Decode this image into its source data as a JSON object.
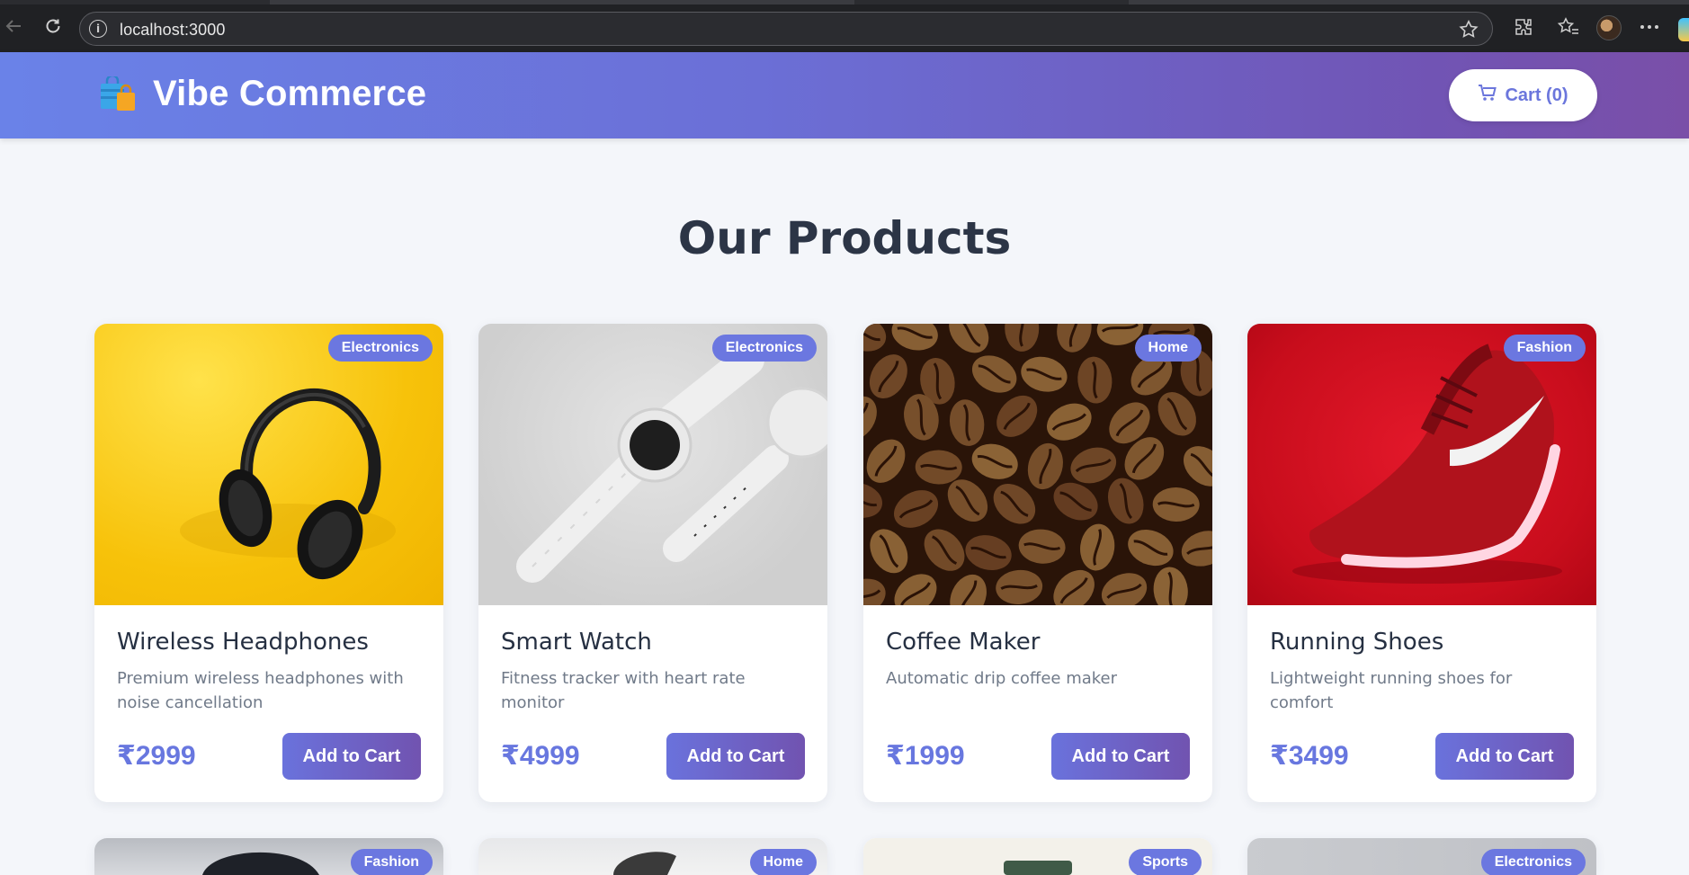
{
  "browser": {
    "url": "localhost:3000"
  },
  "header": {
    "brand": "Vibe Commerce",
    "cart_label": "Cart (0)"
  },
  "main": {
    "title": "Our Products",
    "products": [
      {
        "name": "Wireless Headphones",
        "description": "Premium wireless headphones with noise cancellation",
        "price": "₹2999",
        "category": "Electronics",
        "button": "Add to Cart"
      },
      {
        "name": "Smart Watch",
        "description": "Fitness tracker with heart rate monitor",
        "price": "₹4999",
        "category": "Electronics",
        "button": "Add to Cart"
      },
      {
        "name": "Coffee Maker",
        "description": "Automatic drip coffee maker",
        "price": "₹1999",
        "category": "Home",
        "button": "Add to Cart"
      },
      {
        "name": "Running Shoes",
        "description": "Lightweight running shoes for comfort",
        "price": "₹3499",
        "category": "Fashion",
        "button": "Add to Cart"
      }
    ],
    "next_row_categories": [
      "Fashion",
      "Home",
      "Sports",
      "Electronics"
    ]
  },
  "colors": {
    "accent": "#6b77e0",
    "header_start": "#6a82e8",
    "header_end": "#7a4fa8",
    "title": "#2c3546"
  }
}
